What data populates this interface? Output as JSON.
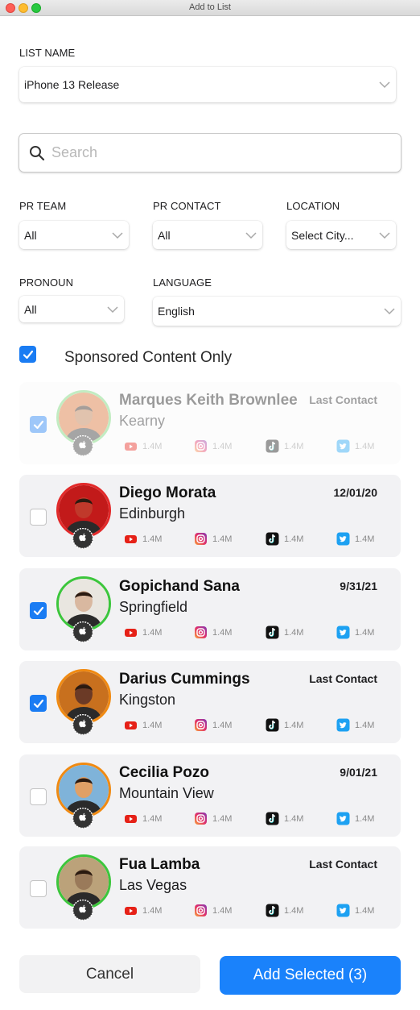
{
  "window": {
    "title": "Add to List"
  },
  "list_name": {
    "label": "LIST NAME",
    "value": "iPhone 13 Release"
  },
  "search": {
    "placeholder": "Search"
  },
  "filters": {
    "pr_team": {
      "label": "PR TEAM",
      "value": "All"
    },
    "pr_contact": {
      "label": "PR CONTACT",
      "value": "All"
    },
    "location": {
      "label": "LOCATION",
      "value": "Select City..."
    },
    "pronoun": {
      "label": "PRONOUN",
      "value": "All"
    },
    "language": {
      "label": "LANGUAGE",
      "value": "English"
    }
  },
  "sponsored": {
    "label": "Sponsored Content Only",
    "checked": true
  },
  "contacts": [
    {
      "name": "Marques Keith Brownlee",
      "city": "Kearny",
      "date": "Last Contact",
      "checked": true,
      "faded": true,
      "ring": "#6fd46f",
      "stats": {
        "youtube": "1.4M",
        "instagram": "1.4M",
        "tiktok": "1.4M",
        "twitter": "1.4M"
      }
    },
    {
      "name": "Diego Morata",
      "city": "Edinburgh",
      "date": "12/01/20",
      "checked": false,
      "faded": false,
      "ring": "#e22a2a",
      "stats": {
        "youtube": "1.4M",
        "instagram": "1.4M",
        "tiktok": "1.4M",
        "twitter": "1.4M"
      }
    },
    {
      "name": "Gopichand Sana",
      "city": "Springfield",
      "date": "9/31/21",
      "checked": true,
      "faded": false,
      "ring": "#3cc63c",
      "stats": {
        "youtube": "1.4M",
        "instagram": "1.4M",
        "tiktok": "1.4M",
        "twitter": "1.4M"
      }
    },
    {
      "name": "Darius Cummings",
      "city": "Kingston",
      "date": "Last Contact",
      "checked": true,
      "faded": false,
      "ring": "#f08a12",
      "stats": {
        "youtube": "1.4M",
        "instagram": "1.4M",
        "tiktok": "1.4M",
        "twitter": "1.4M"
      }
    },
    {
      "name": "Cecilia Pozo",
      "city": "Mountain View",
      "date": "9/01/21",
      "checked": false,
      "faded": false,
      "ring": "#f08a12",
      "stats": {
        "youtube": "1.4M",
        "instagram": "1.4M",
        "tiktok": "1.4M",
        "twitter": "1.4M"
      }
    },
    {
      "name": "Fua Lamba",
      "city": "Las Vegas",
      "date": "Last Contact",
      "checked": false,
      "faded": false,
      "ring": "#3cc63c",
      "stats": {
        "youtube": "1.4M",
        "instagram": "1.4M",
        "tiktok": "1.4M",
        "twitter": "1.4M"
      }
    }
  ],
  "actions": {
    "cancel": "Cancel",
    "add_selected": "Add Selected (3)"
  },
  "colors": {
    "accent": "#1a82fb",
    "checkbox": "#1a7cf3",
    "card_bg": "#f2f2f4"
  }
}
